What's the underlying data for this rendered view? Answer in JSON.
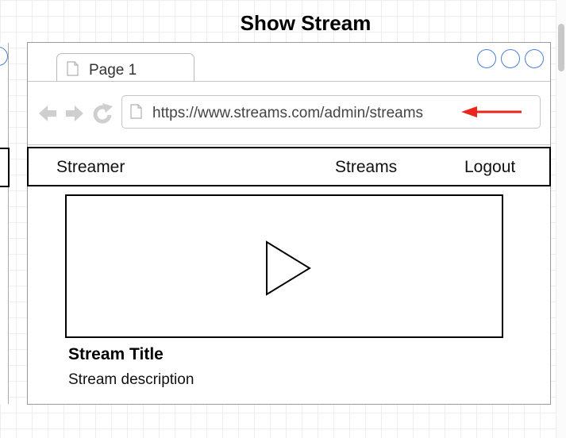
{
  "diagram_title": "Show Stream",
  "browser": {
    "tab_label": "Page 1",
    "url": "https://www.streams.com/admin/streams",
    "arrow_color": "#e8261c"
  },
  "navbar": {
    "brand": "Streamer",
    "streams_link": "Streams",
    "logout_link": "Logout"
  },
  "content": {
    "stream_title": "Stream Title",
    "stream_description": "Stream description"
  },
  "icons": [
    "document-icon",
    "back-arrow-icon",
    "forward-arrow-icon",
    "refresh-icon",
    "play-icon",
    "window-control-icon"
  ]
}
